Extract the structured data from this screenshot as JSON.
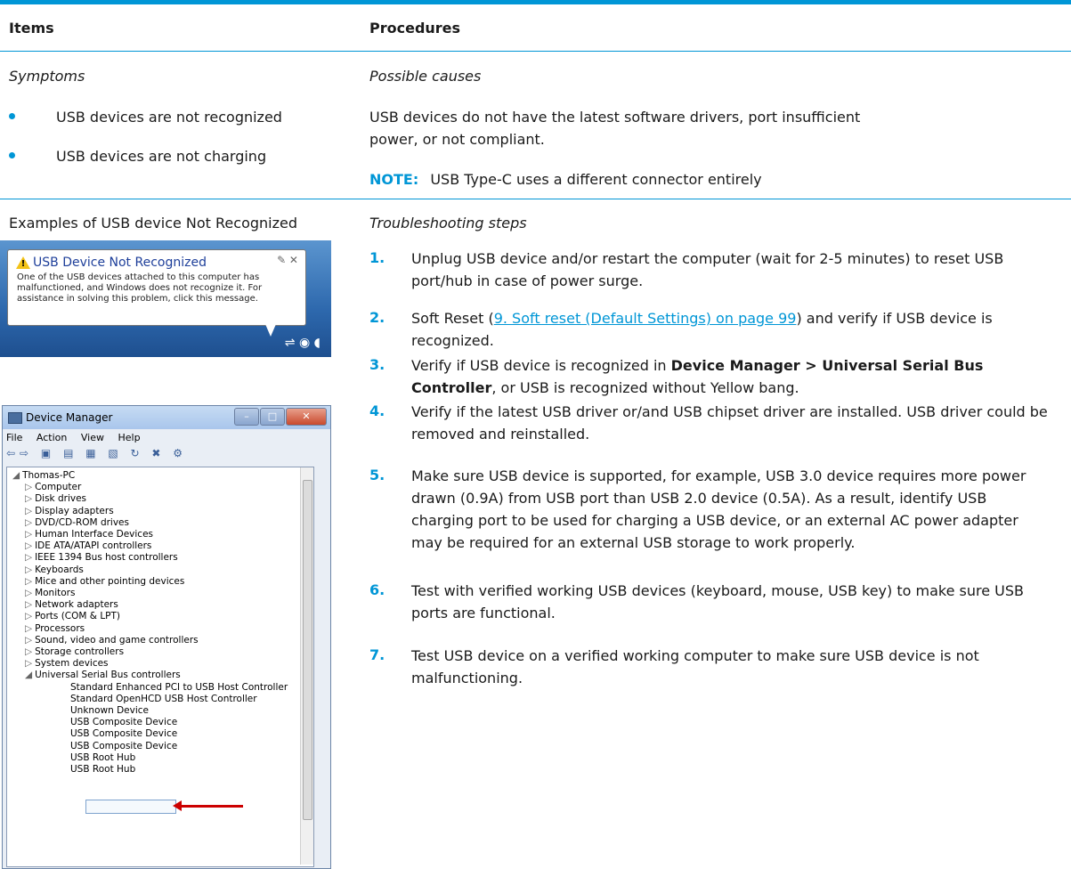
{
  "header": {
    "col1": "Items",
    "col2": "Procedures"
  },
  "row1": {
    "symptoms_label": "Symptoms",
    "symptoms": [
      "USB devices are not recognized",
      "USB devices are not charging"
    ],
    "causes_label": "Possible causes",
    "causes_text": "USB devices do not have the latest software drivers, port insufficient power, or not compliant.",
    "note_label": "NOTE:",
    "note_text": "USB Type-C uses a different connector entirely"
  },
  "row2": {
    "examples_label": "Examples of USB device Not Recognized",
    "steps_label": "Troubleshooting steps",
    "steps": [
      {
        "num": "1.",
        "text": "Unplug USB device and/or restart the computer (wait for 2-5 minutes) to reset USB port/hub in case of power surge."
      },
      {
        "num": "2.",
        "pre": "Soft Reset (",
        "link": "9. Soft reset (Default Settings) on page 99",
        "post": ") and verify if USB device is recognized."
      },
      {
        "num": "3.",
        "pre": "Verify if USB device is recognized in ",
        "bold": "Device Manager > Universal Serial Bus Controller",
        "post": ", or USB is recognized without Yellow bang."
      },
      {
        "num": "4.",
        "text": "Verify if the latest USB driver or/and USB chipset driver are installed. USB driver could be removed and reinstalled."
      },
      {
        "num": "5.",
        "text": "Make sure USB device is supported, for example, USB 3.0 device requires more power drawn (0.9A) from USB port than USB 2.0 device (0.5A). As a result, identify USB charging port to be used for charging a USB device, or an external AC power adapter may be required for an external USB storage to work properly."
      },
      {
        "num": "6.",
        "text": "Test with verified working USB devices (keyboard, mouse, USB key) to make sure USB ports are functional."
      },
      {
        "num": "7.",
        "text": "Test USB device on a verified working computer to make sure USB device is not malfunctioning."
      }
    ]
  },
  "notification": {
    "title": "USB Device Not Recognized",
    "body": "One of the USB devices attached to this computer has malfunctioned, and Windows does not recognize it. For assistance in solving this problem, click this message.",
    "controls": "✎ ✕"
  },
  "device_manager": {
    "title": "Device Manager",
    "menu": [
      "File",
      "Action",
      "View",
      "Help"
    ],
    "toolbar_glyphs": "⇦⇨ ▣ ▤ ▦ ▧ ↻ ✖ ⚙",
    "root": "Thomas-PC",
    "items": [
      "Computer",
      "Disk drives",
      "Display adapters",
      "DVD/CD-ROM drives",
      "Human Interface Devices",
      "IDE ATA/ATAPI controllers",
      "IEEE 1394 Bus host controllers",
      "Keyboards",
      "Mice and other pointing devices",
      "Monitors",
      "Network adapters",
      "Ports (COM & LPT)",
      "Processors",
      "Sound, video and game controllers",
      "Storage controllers",
      "System devices",
      "Universal Serial Bus controllers"
    ],
    "usb_children": [
      "Standard Enhanced PCI to USB Host Controller",
      "Standard OpenHCD USB Host Controller",
      "Unknown Device",
      "USB Composite Device",
      "USB Composite Device",
      "USB Composite Device",
      "USB Root Hub",
      "USB Root Hub"
    ]
  }
}
